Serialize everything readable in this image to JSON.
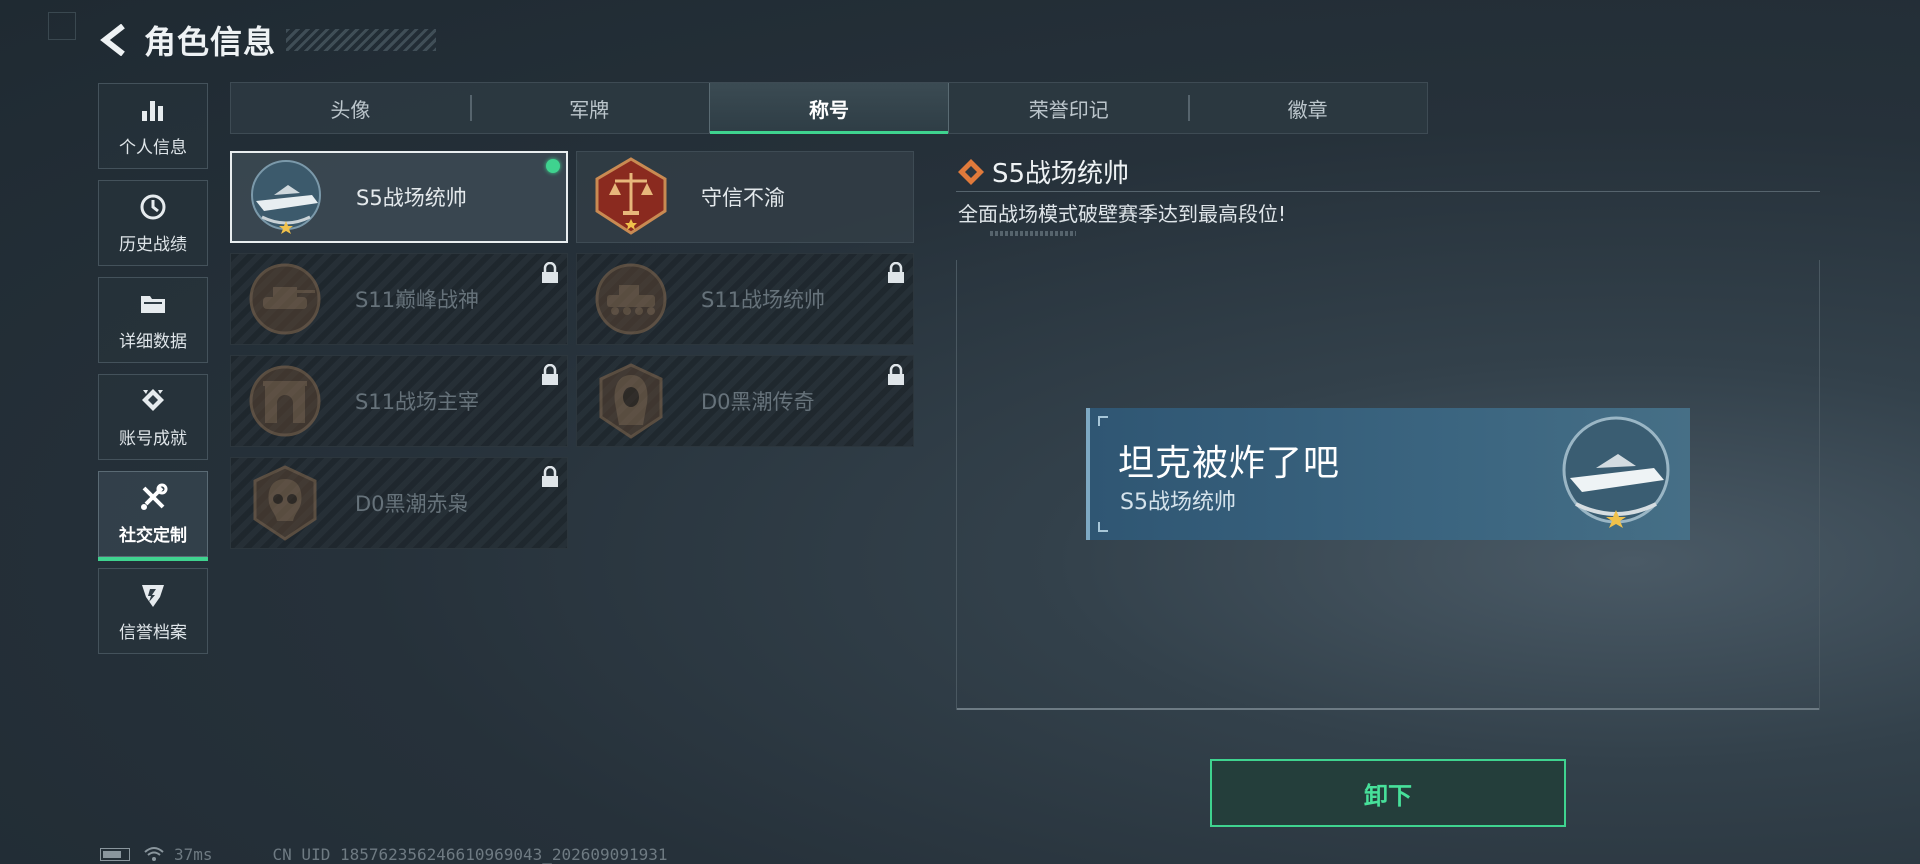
{
  "header": {
    "title": "角色信息",
    "back_icon": "back-arrow-icon"
  },
  "sidebar": {
    "items": [
      {
        "label": "个人信息",
        "icon": "bar-chart-icon",
        "active": false
      },
      {
        "label": "历史战绩",
        "icon": "clock-icon",
        "active": false
      },
      {
        "label": "详细数据",
        "icon": "folder-icon",
        "active": false
      },
      {
        "label": "账号成就",
        "icon": "achievement-icon",
        "active": false
      },
      {
        "label": "社交定制",
        "icon": "tools-icon",
        "active": true
      },
      {
        "label": "信誉档案",
        "icon": "shield-badge-icon",
        "active": false
      }
    ]
  },
  "tabs": [
    {
      "label": "头像",
      "active": false
    },
    {
      "label": "军牌",
      "active": false
    },
    {
      "label": "称号",
      "active": true
    },
    {
      "label": "荣誉印记",
      "active": false
    },
    {
      "label": "徽章",
      "active": false
    }
  ],
  "titles": [
    {
      "label": "S5战场统帅",
      "medal": "speedboat-medal-icon",
      "locked": false,
      "selected": true,
      "equipped": true
    },
    {
      "label": "守信不渝",
      "medal": "scales-medal-icon",
      "locked": false,
      "selected": false,
      "equipped": false
    },
    {
      "label": "S11巅峰战神",
      "medal": "tank-medal-icon",
      "locked": true,
      "selected": false,
      "equipped": false
    },
    {
      "label": "S11战场统帅",
      "medal": "armored-vehicle-medal-icon",
      "locked": true,
      "selected": false,
      "equipped": false
    },
    {
      "label": "S11战场主宰",
      "medal": "arch-medal-icon",
      "locked": true,
      "selected": false,
      "equipped": false
    },
    {
      "label": "D0黑潮传奇",
      "medal": "hooded-figure-medal-icon",
      "locked": true,
      "selected": false,
      "equipped": false
    },
    {
      "label": "D0黑潮赤枭",
      "medal": "skull-medal-icon",
      "locked": true,
      "selected": false,
      "equipped": false
    }
  ],
  "detail": {
    "title": "S5战场统帅",
    "description": "全面战场模式破壁赛季达到最高段位!",
    "preview": {
      "player_name": "坦克被炸了吧",
      "title_label": "S5战场统帅"
    },
    "action_label": "卸下"
  },
  "status": {
    "ping": "37ms",
    "uid": "CN UID 1857623562466109690​43_202609091931"
  },
  "colors": {
    "accent": "#3fd38f",
    "plate": "#3b6580"
  }
}
